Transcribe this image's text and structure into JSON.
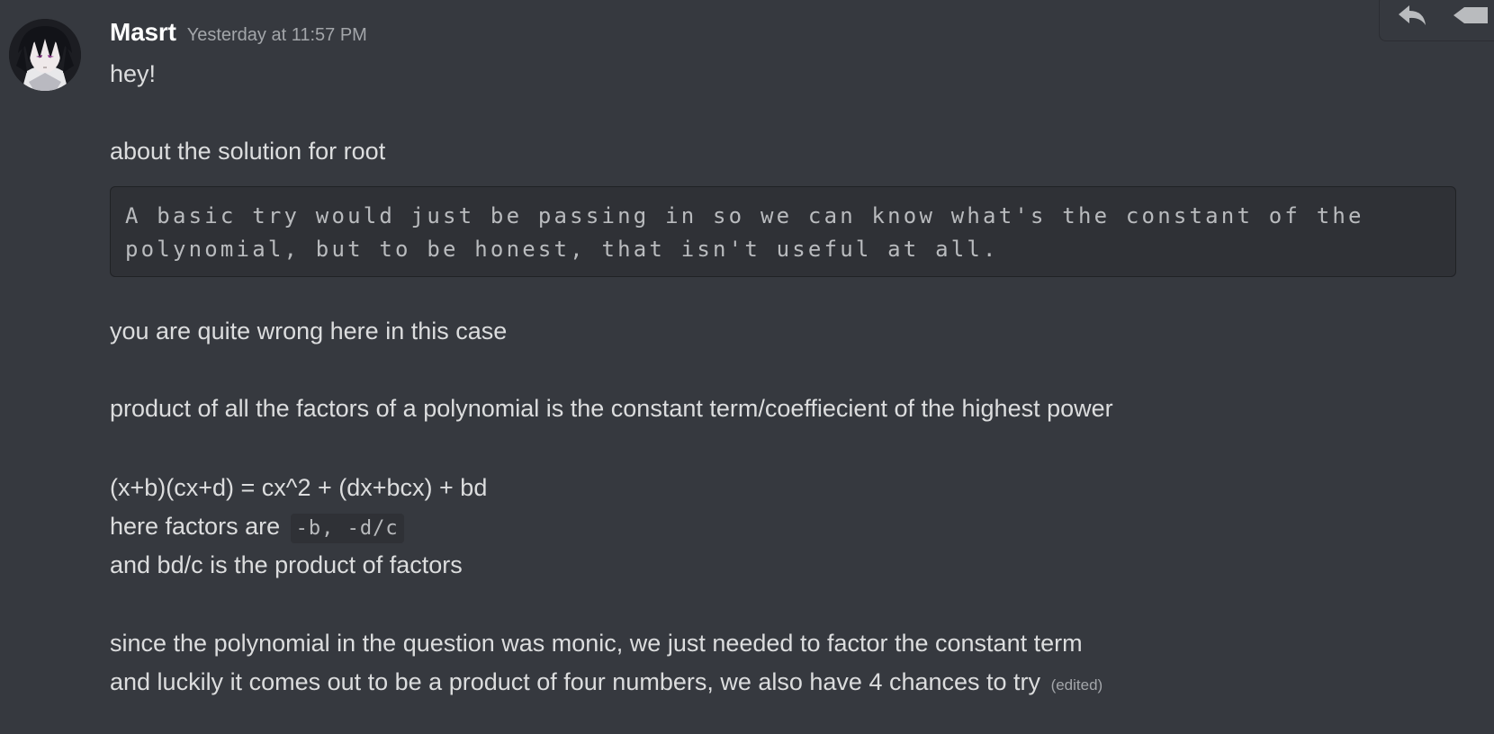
{
  "message": {
    "author": "Masrt",
    "timestamp": "Yesterday at 11:57 PM",
    "lines": {
      "l1": "hey!",
      "l2": "about the solution for root",
      "l3": "you are quite wrong here in this case",
      "l4": "product of all the factors of  a polynomial is the constant term/coeffiecient of the highest power",
      "l5": "(x+b)(cx+d) = cx^2 + (dx+bcx) + bd",
      "l6_prefix": "here factors are",
      "l7": "and bd/c is the product of factors",
      "l8": "since the polynomial  in the question was monic, we just needed to factor the constant term",
      "l9": "and luckily it comes out to be a product of four numbers, we also have 4 chances to try"
    },
    "inline_code": "-b, -d/c",
    "code_block": {
      "line1": "A basic try would just be passing in so we can know what's the constant of the",
      "line2": "polynomial, but to be honest, that isn't useful at all."
    },
    "edited_label": "(edited)"
  },
  "toolbar": {
    "buttons": [
      {
        "icon": "reply-icon"
      },
      {
        "icon": "more-icon"
      }
    ]
  },
  "colors": {
    "background": "#36393f",
    "code_background": "#2f3136",
    "username": "#ffffff",
    "text": "#dcddde",
    "muted": "#a3a6aa"
  }
}
